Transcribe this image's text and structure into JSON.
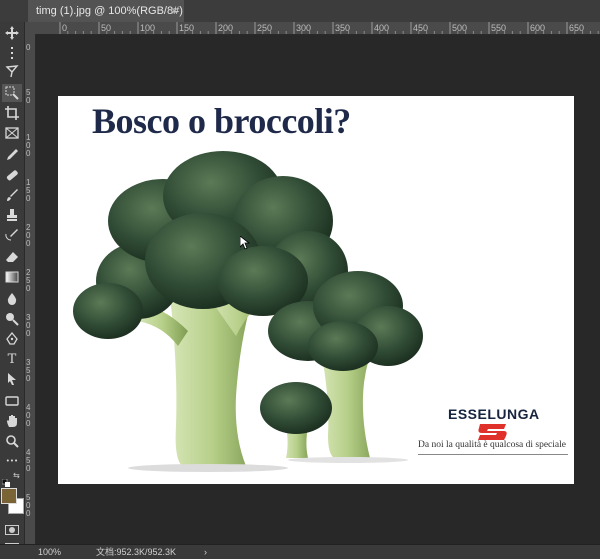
{
  "window": {
    "tab_title": "timg (1).jpg @ 100%(RGB/8#)",
    "tab_close": "×"
  },
  "ruler": {
    "top_ticks": [
      "0",
      "50",
      "100",
      "150",
      "200",
      "250",
      "300",
      "350",
      "400",
      "450",
      "500",
      "550",
      "600",
      "650"
    ],
    "left_ticks": [
      "0",
      "5 0",
      "1 0 0",
      "1 5 0",
      "2 0 0",
      "2 5 0",
      "3 0 0",
      "3 5 0",
      "4 0 0",
      "4 5 0",
      "5 0 0"
    ]
  },
  "tools": [
    {
      "name": "move-tool",
      "icon": "move-icon"
    },
    {
      "name": "artboard-tool",
      "icon": "dotted-icon"
    },
    {
      "name": "lasso-tool",
      "icon": "lasso-icon"
    },
    {
      "name": "quick-select-tool",
      "icon": "select-icon"
    },
    {
      "name": "crop-tool",
      "icon": "crop-icon"
    },
    {
      "name": "frame-tool",
      "icon": "frame-icon"
    },
    {
      "name": "eyedropper-tool",
      "icon": "eyedropper-icon"
    },
    {
      "name": "healing-tool",
      "icon": "bandage-icon"
    },
    {
      "name": "brush-tool",
      "icon": "brush-icon"
    },
    {
      "name": "stamp-tool",
      "icon": "stamp-icon"
    },
    {
      "name": "history-brush-tool",
      "icon": "history-brush-icon"
    },
    {
      "name": "eraser-tool",
      "icon": "eraser-icon"
    },
    {
      "name": "gradient-tool",
      "icon": "gradient-icon"
    },
    {
      "name": "blur-tool",
      "icon": "drop-icon"
    },
    {
      "name": "dodge-tool",
      "icon": "dodge-icon"
    },
    {
      "name": "pen-tool",
      "icon": "pen-icon"
    },
    {
      "name": "type-tool",
      "icon": "type-icon",
      "glyph": "T"
    },
    {
      "name": "path-select-tool",
      "icon": "arrow-icon"
    },
    {
      "name": "shape-tool",
      "icon": "rectangle-icon"
    },
    {
      "name": "hand-tool",
      "icon": "hand-icon"
    },
    {
      "name": "zoom-tool",
      "icon": "zoom-icon"
    },
    {
      "name": "more-tools",
      "icon": "ellipsis-icon",
      "glyph": "•••"
    }
  ],
  "colors": {
    "foreground": "#7a6435",
    "background": "#ffffff",
    "headline": "#1f2a4a",
    "logo_red": "#e0302a"
  },
  "image": {
    "headline": "Bosco o broccoli?",
    "logo": "ESSELUNGA",
    "tagline": "Da noi la qualità è qualcosa di speciale"
  },
  "status": {
    "zoom": "100%",
    "doc_info": "文档:952.3K/952.3K",
    "arrow": "›"
  }
}
